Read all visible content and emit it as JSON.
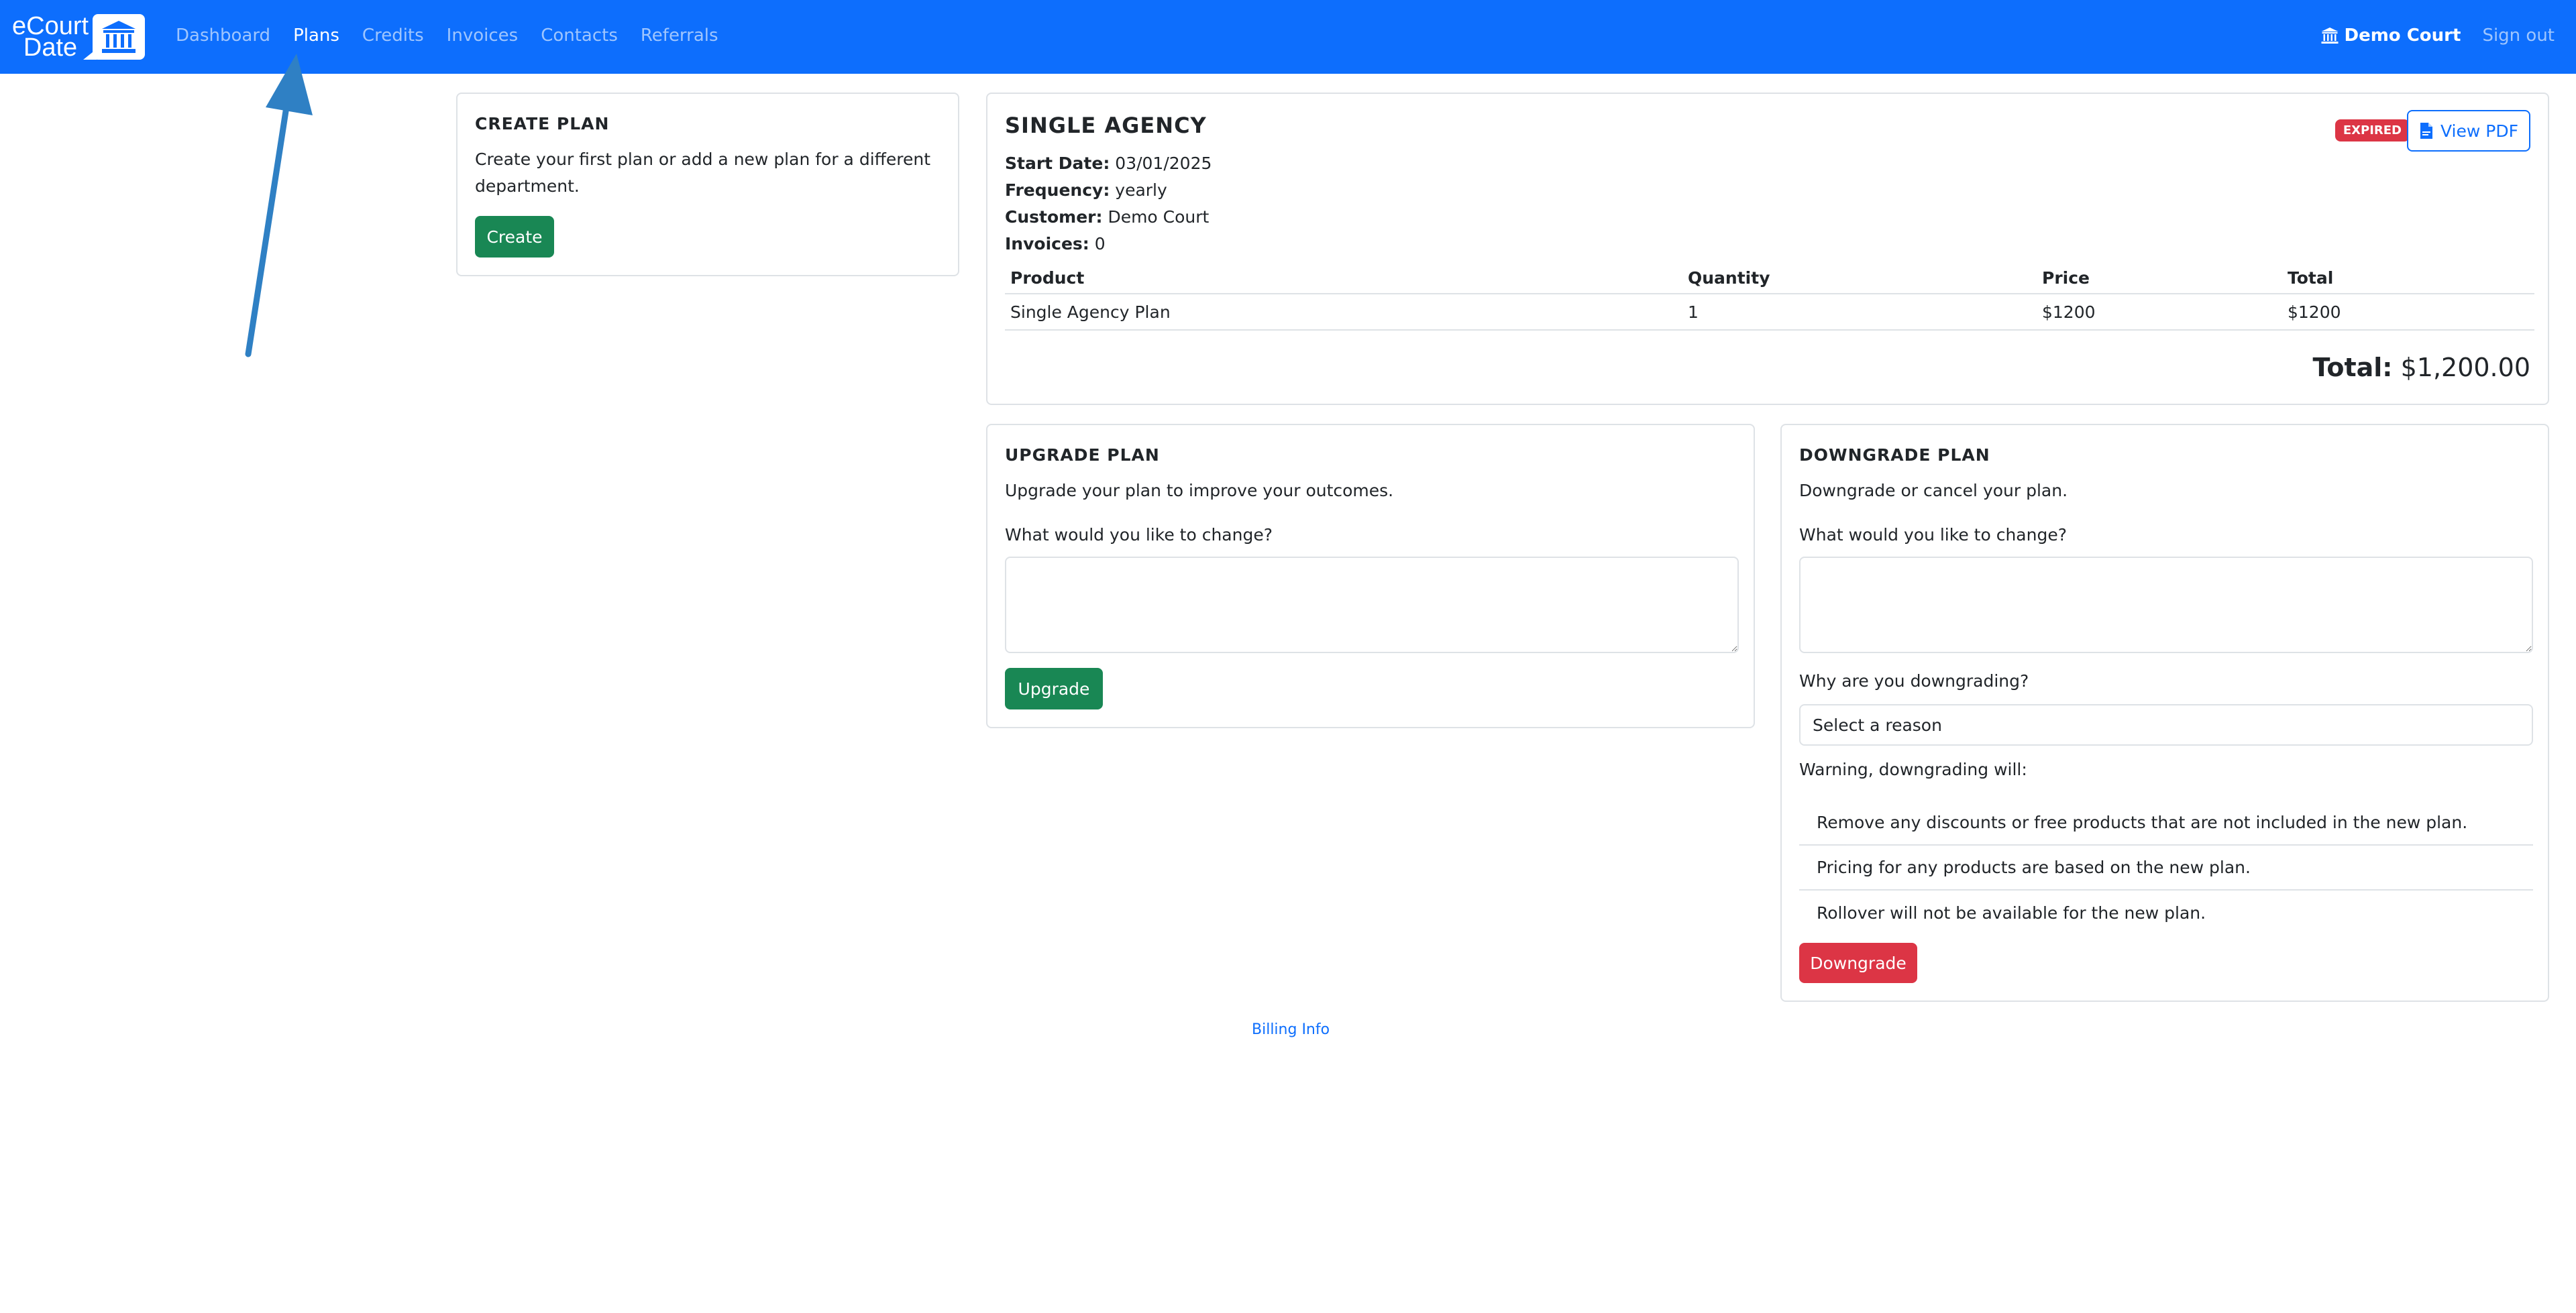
{
  "brand": {
    "line1": "eCourt",
    "line2": "Date",
    "icon": "courthouse-icon"
  },
  "nav": {
    "links": [
      "Dashboard",
      "Plans",
      "Credits",
      "Invoices",
      "Contacts",
      "Referrals"
    ],
    "active": "Plans",
    "court_name": "Demo Court",
    "court_icon": "courthouse-icon",
    "sign_out": "Sign out"
  },
  "create_plan": {
    "title": "CREATE PLAN",
    "text": "Create your first plan or add a new plan for a different department.",
    "button": "Create"
  },
  "plan": {
    "title": "SINGLE AGENCY",
    "status_badge": "EXPIRED",
    "view_pdf": "View PDF",
    "fields": [
      {
        "label": "Start Date:",
        "value": "03/01/2025"
      },
      {
        "label": "Frequency:",
        "value": "yearly"
      },
      {
        "label": "Customer:",
        "value": "Demo Court"
      },
      {
        "label": "Invoices:",
        "value": "0"
      }
    ],
    "columns": [
      "Product",
      "Quantity",
      "Price",
      "Total"
    ],
    "rows": [
      [
        "Single Agency Plan",
        "1",
        "$1200",
        "$1200"
      ]
    ],
    "total_label": "Total:",
    "total_value": "$1,200.00"
  },
  "upgrade": {
    "title": "UPGRADE PLAN",
    "text": "Upgrade your plan to improve your outcomes.",
    "question": "What would you like to change?",
    "textarea_value": "",
    "button": "Upgrade"
  },
  "downgrade": {
    "title": "DOWNGRADE PLAN",
    "text": "Downgrade or cancel your plan.",
    "question": "What would you like to change?",
    "textarea_value": "",
    "reason_label": "Why are you downgrading?",
    "reason_selected": "Select a reason",
    "warning_label": "Warning, downgrading will:",
    "warnings": [
      "Remove any discounts or free products that are not included in the new plan.",
      "Pricing for any products are based on the new plan.",
      "Rollover will not be available for the new plan."
    ],
    "button": "Downgrade"
  },
  "footer": {
    "link": "Billing Info"
  },
  "colors": {
    "primary": "#0d6efd",
    "success": "#198754",
    "danger": "#dc3545",
    "annotation_arrow": "#2f80c4"
  }
}
